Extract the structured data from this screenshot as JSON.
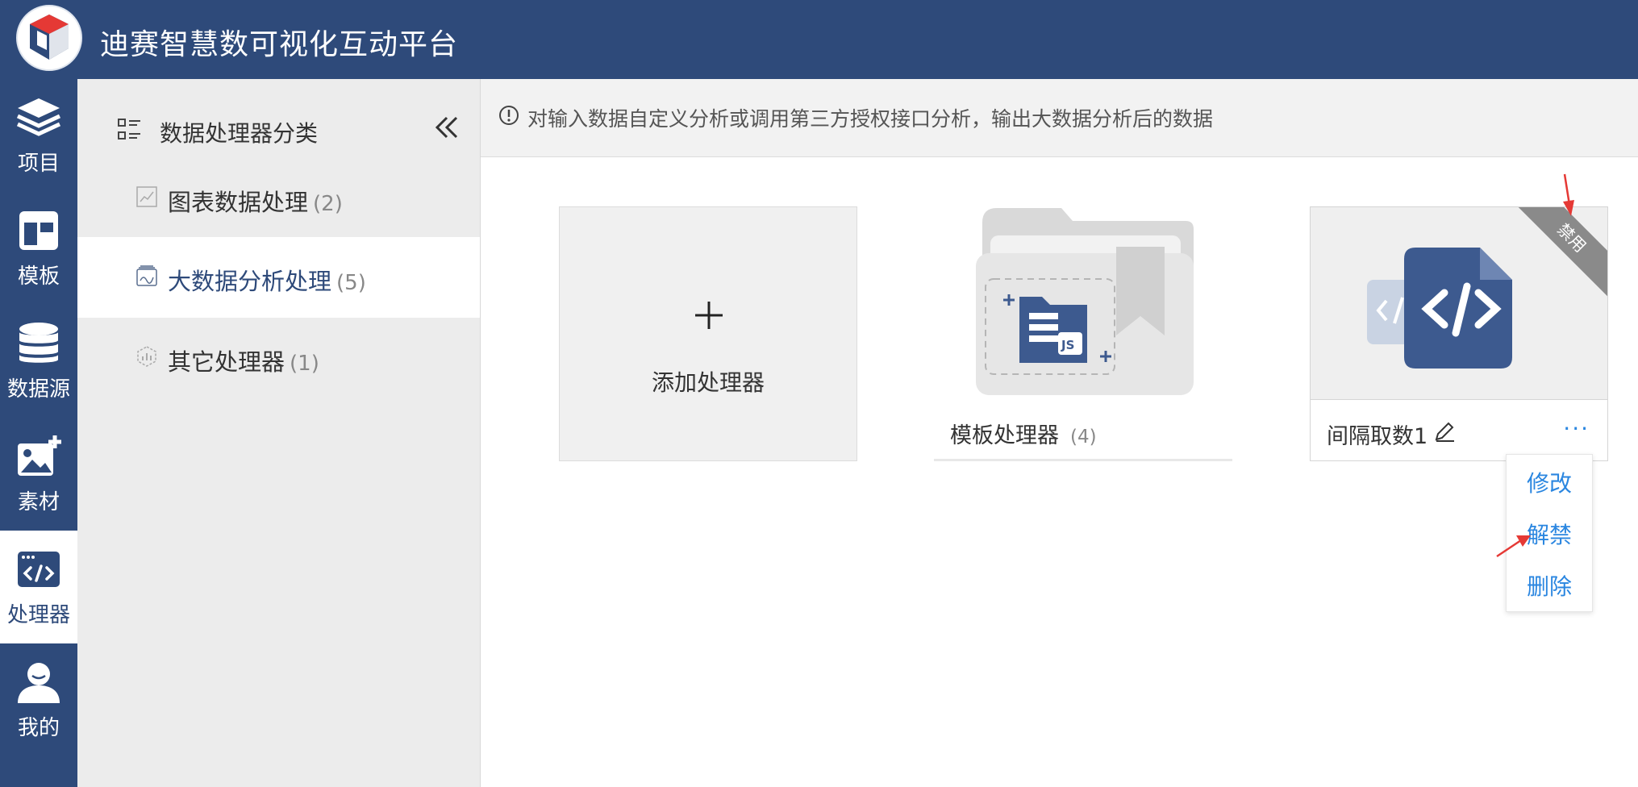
{
  "header": {
    "title": "迪赛智慧数可视化互动平台"
  },
  "rail": {
    "items": [
      {
        "label": "项目",
        "icon": "layers-icon"
      },
      {
        "label": "模板",
        "icon": "template-icon"
      },
      {
        "label": "数据源",
        "icon": "database-icon"
      },
      {
        "label": "素材",
        "icon": "image-add-icon"
      },
      {
        "label": "处理器",
        "icon": "code-window-icon"
      },
      {
        "label": "我的",
        "icon": "user-icon"
      }
    ],
    "active_index": 4
  },
  "categories": {
    "title": "数据处理器分类",
    "items": [
      {
        "label": "图表数据处理",
        "count": "(2)"
      },
      {
        "label": "大数据分析处理",
        "count": "(5)"
      },
      {
        "label": "其它处理器",
        "count": "(1)"
      }
    ],
    "active_index": 1
  },
  "info": {
    "text": "对输入数据自定义分析或调用第三方授权接口分析，输出大数据分析后的数据"
  },
  "cards": {
    "add_label": "添加处理器",
    "template": {
      "label": "模板处理器",
      "count": "(4)"
    },
    "processor": {
      "name": "间隔取数1",
      "ribbon": "禁用",
      "more": "···"
    }
  },
  "menu": {
    "items": [
      "修改",
      "解禁",
      "删除"
    ]
  },
  "colors": {
    "brand": "#2e4a7a",
    "link": "#2a86e0",
    "annotation": "#e53935"
  }
}
